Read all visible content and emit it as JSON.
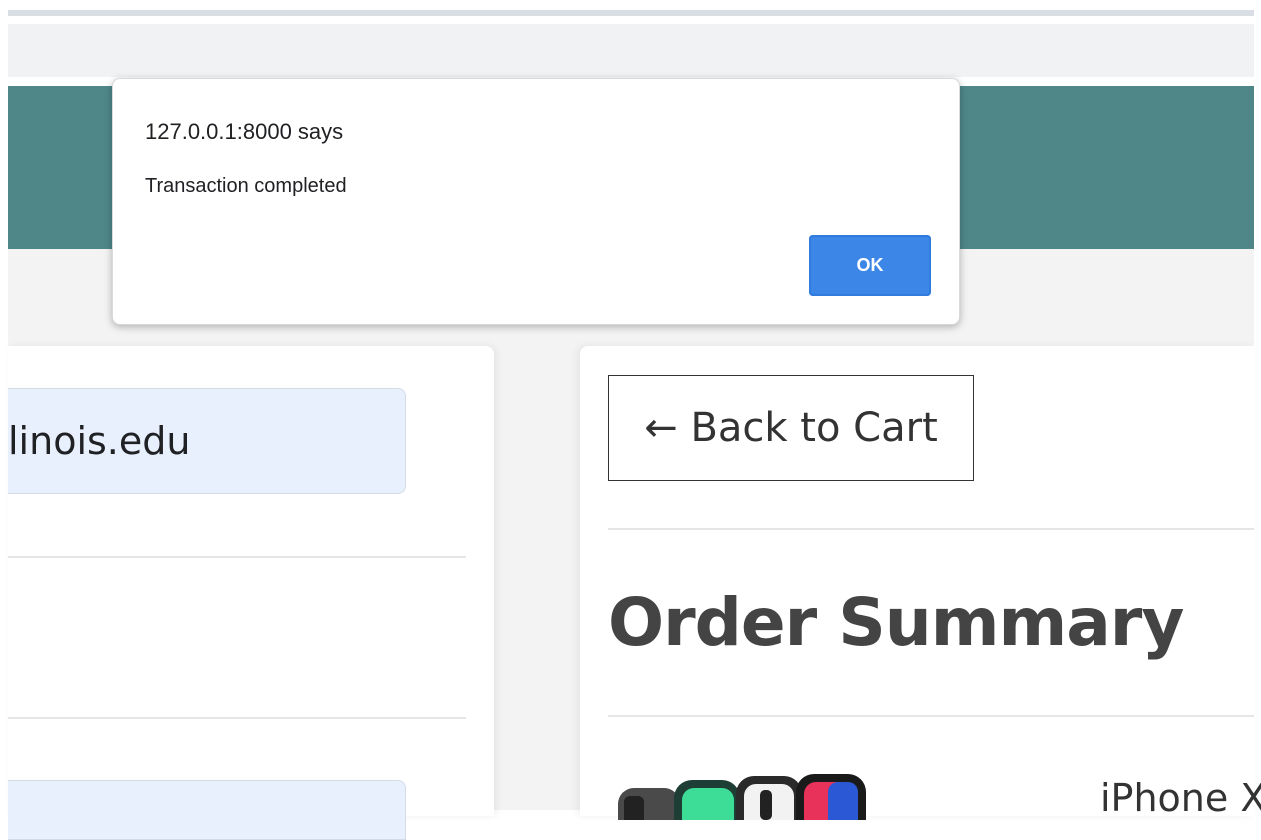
{
  "alert": {
    "origin_text": "127.0.0.1:8000 says",
    "message": "Transaction completed",
    "ok_label": "OK"
  },
  "checkout_form": {
    "email_value": "linois.edu"
  },
  "order_panel": {
    "back_label": "← Back to Cart",
    "title": "Order Summary",
    "product_name": "iPhone X"
  },
  "colors": {
    "nav_bar": "#4f8789",
    "ok_button": "#3b86e6",
    "field_bg": "#e8f0fe"
  },
  "icons": {
    "product_image": "iphone-x-colors-image"
  }
}
